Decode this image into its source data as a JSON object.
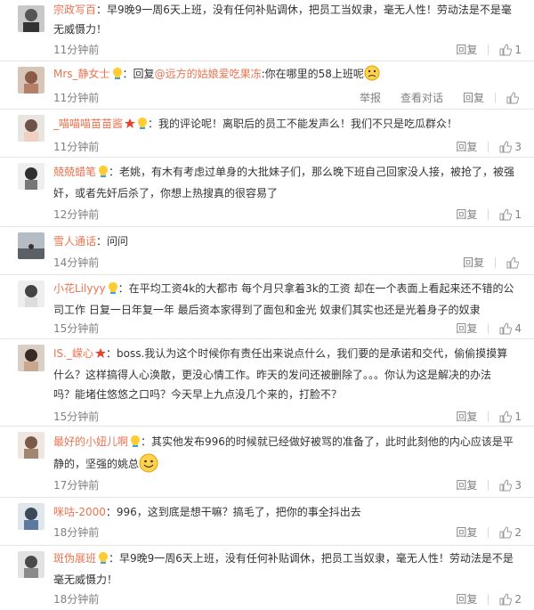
{
  "comments": [
    {
      "user": "宗政写百",
      "text_lines": [
        "：早9晚9一周6天上班，没有任何补贴调休，把员工当奴隶，毫无人性！劳动法是不是毫",
        "无威慑力！"
      ],
      "time": "11分钟前",
      "reply": "回复",
      "likes": "1"
    },
    {
      "user": "Mrs_静女士",
      "reply_prefix": "：回复",
      "mention": "@远方的姑娘爱吃果冻",
      "text": ":你在哪里的58上班呢",
      "time": "11分钟前",
      "report": "举报",
      "view_dialog": "查看对话",
      "reply": "回复",
      "likes": ""
    },
    {
      "user": "_喵喵喵苗苗酱",
      "text": "：我的评论呢！离职后的员工不能发声么！我们不只是吃瓜群众！",
      "time": "11分钟前",
      "reply": "回复",
      "likes": "3"
    },
    {
      "user": "兢兢蜡笔",
      "text_lines": [
        "：老姚，有木有考虑过单身的大批妹子们，那么晚下班自己回家没人接，被抢了，被强",
        "奸，或者先奸后杀了，你想上热搜真的很容易了"
      ],
      "time": "12分钟前",
      "reply": "回复",
      "likes": "1"
    },
    {
      "user": "雪人通话",
      "text": "：问问",
      "time": "14分钟前",
      "reply": "回复",
      "likes": ""
    },
    {
      "user": "小花Lilyyy",
      "text_lines": [
        "：在平均工资4k的大都市 每个月只拿着3k的工资 却在一个表面上看起来还不错的公",
        "司工作 日复一日年复一年 最后资本家得到了面包和金光 奴隶们其实也还是光着身子的奴隶"
      ],
      "time": "15分钟前",
      "reply": "回复",
      "likes": "4"
    },
    {
      "user": "IS._嵘心",
      "text_lines": [
        "：boss.我认为这个时候你有责任出来说点什么，我们要的是承诺和交代，偷偷摸摸算",
        "什么？这样搞得人心涣散，更没心情工作。昨天的发问还被删除了。。。你认为这是解决的办法",
        "吗？能堵住悠悠之口吗？今天早上九点没几个来的，打脸不？"
      ],
      "time": "15分钟前",
      "reply": "回复",
      "likes": "1"
    },
    {
      "user": "最好的小妞儿啊",
      "text_lines": [
        "：其实他发布996的时候就已经做好被骂的准备了，此时此刻他的内心应该是平",
        "静的，坚强的姚总"
      ],
      "time": "17分钟前",
      "reply": "回复",
      "likes": "3"
    },
    {
      "user": "咪咕-2000",
      "text": "：996，这到底是想干嘛？搞毛了，把你的事全抖出去",
      "time": "18分钟前",
      "reply": "回复",
      "likes": "2"
    },
    {
      "user": "斑伪展班",
      "text_lines": [
        "：早9晚9一周6天上班，没有任何补贴调休，把员工当奴隶，毫无人性！劳动法是不是",
        "毫无威慑力！"
      ],
      "time": "18分钟前",
      "reply": "回复",
      "likes": "2"
    }
  ],
  "colors": {
    "username": "#eb7350",
    "meta": "#808080",
    "divider": "#e6e6e6"
  }
}
